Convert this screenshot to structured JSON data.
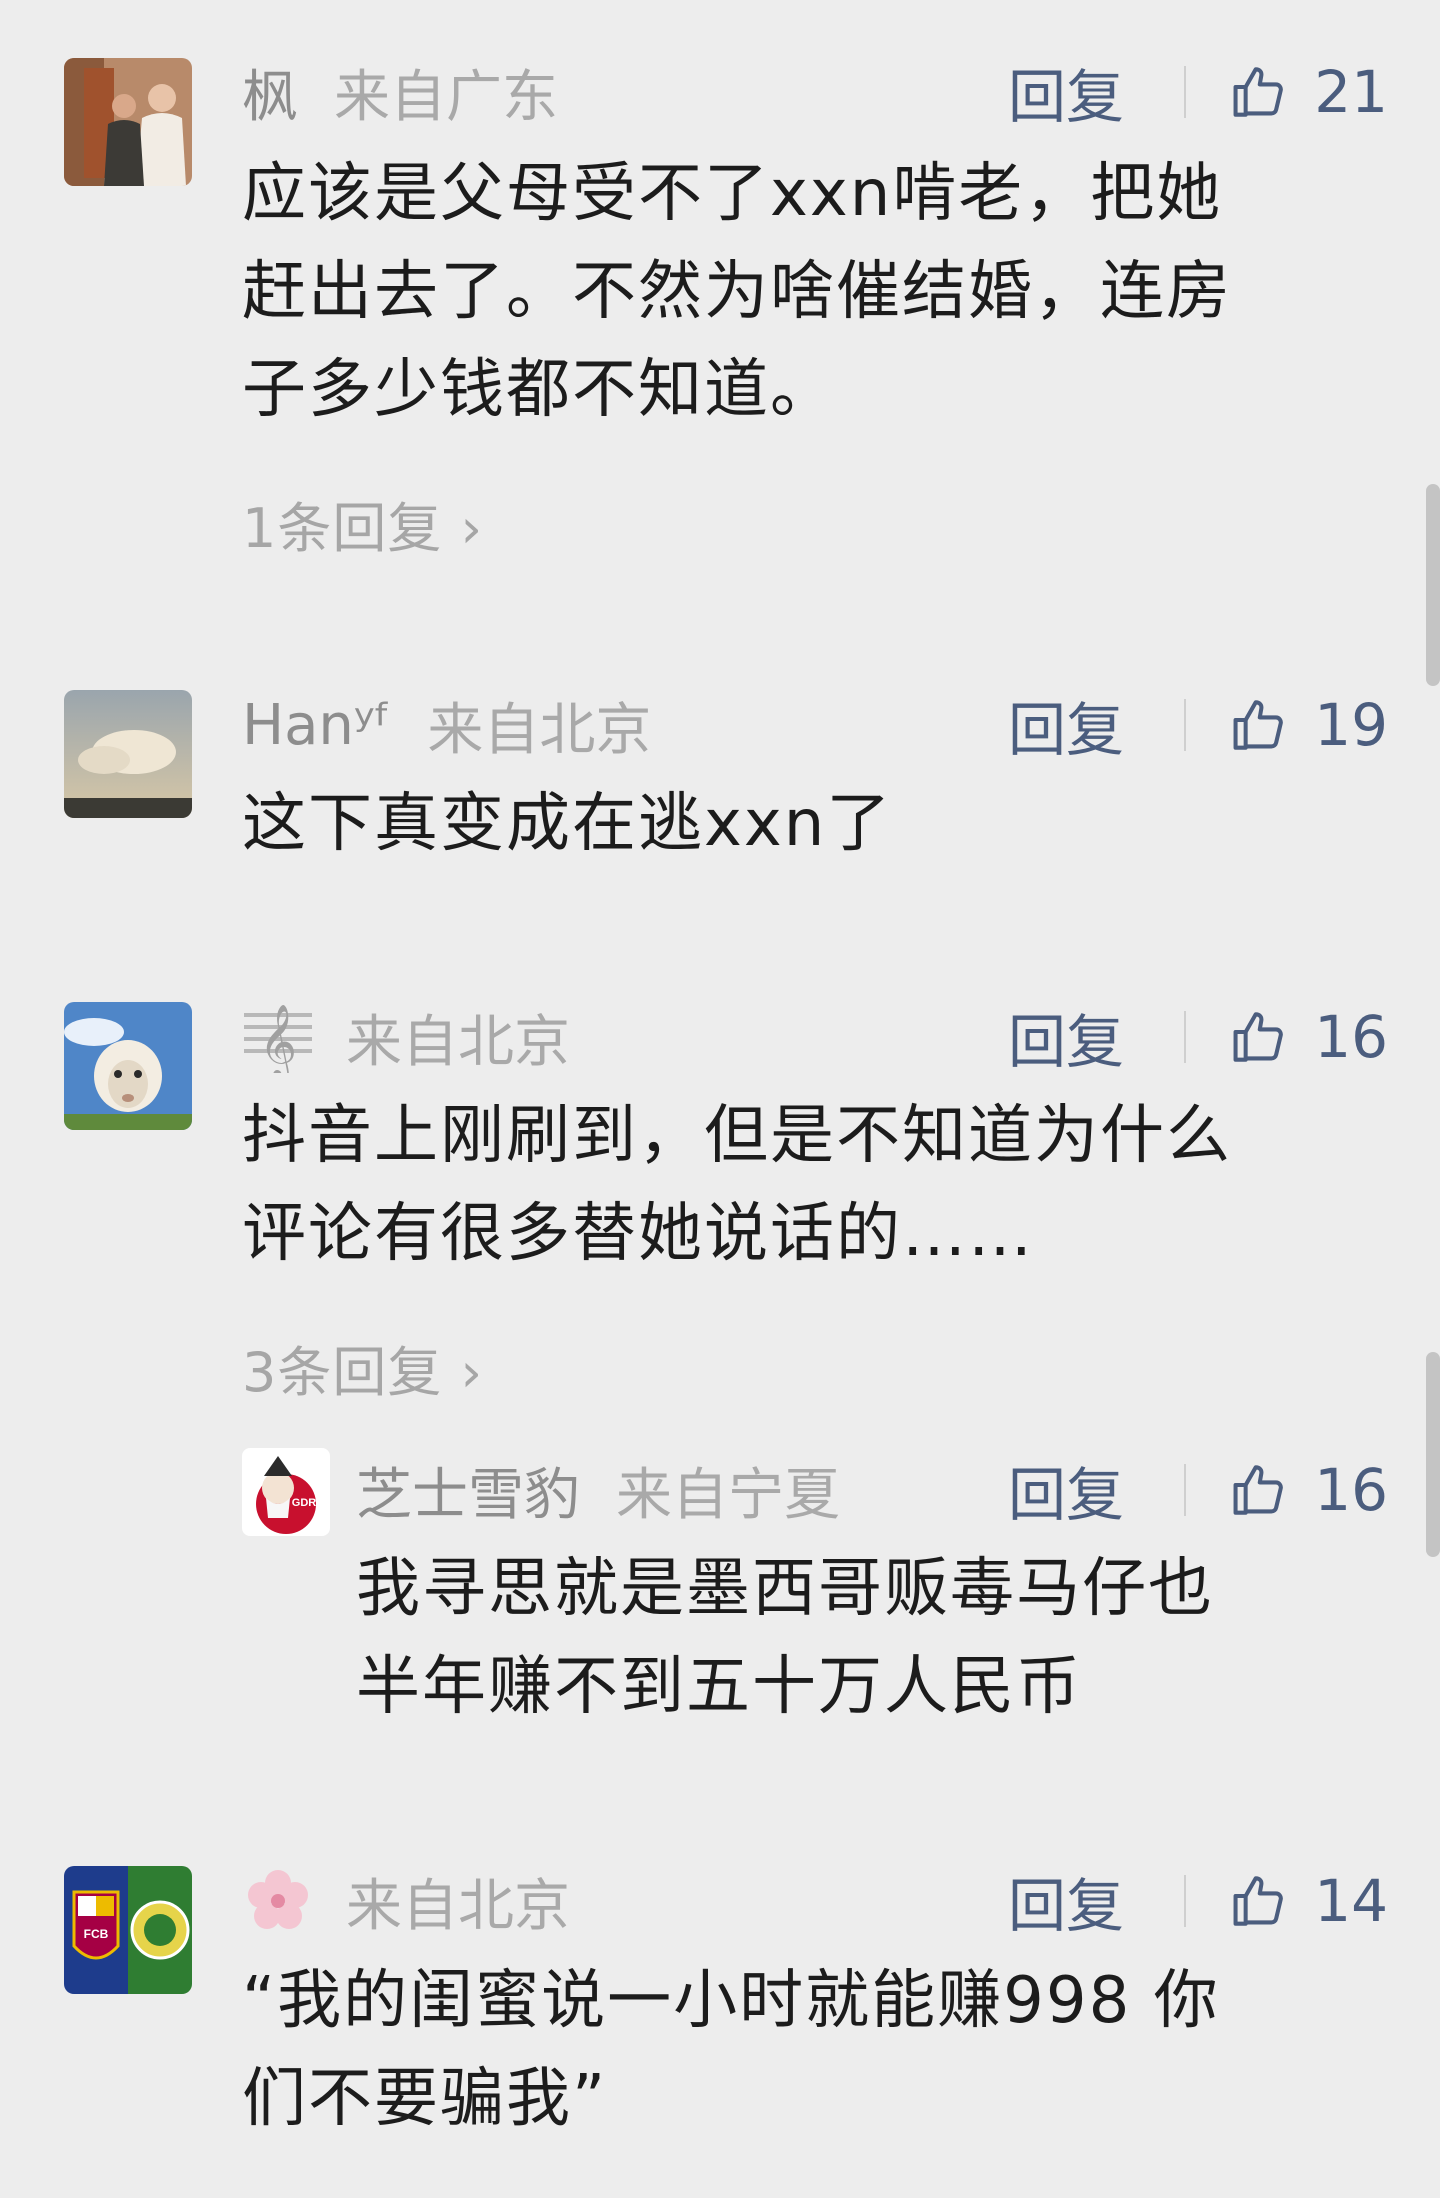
{
  "comments": [
    {
      "name": "枫",
      "location": "来自广东",
      "reply_label": "回复",
      "likes": "21",
      "text_lines": [
        "应该是父母受不了xxn啃老，把她",
        "赶出去了。不然为啥催结婚，连房",
        "子多少钱都不知道。"
      ],
      "replies_link": "1条回复",
      "avatar_icon": "couple-photo-avatar"
    },
    {
      "name": "Hanʸᶠ",
      "location": "来自北京",
      "reply_label": "回复",
      "likes": "19",
      "text_lines": [
        "这下真变成在逃xxn了"
      ],
      "avatar_icon": "sky-clouds-avatar"
    },
    {
      "name_icon": "treble-clef-icon",
      "location": "来自北京",
      "reply_label": "回复",
      "likes": "16",
      "text_lines": [
        "抖音上刚刷到，但是不知道为什么",
        "评论有很多替她说话的……"
      ],
      "replies_link": "3条回复",
      "avatar_icon": "sheep-avatar"
    },
    {
      "name": "芝士雪豹",
      "location": "来自宁夏",
      "reply_label": "回复",
      "likes": "16",
      "text_lines": [
        "我寻思就是墨西哥贩毒马仔也",
        "半年赚不到五十万人民币"
      ],
      "avatar_icon": "colonel-gdr-avatar",
      "avatar_text": "GDR"
    },
    {
      "name_icon": "cherry-blossom-icon",
      "location": "来自北京",
      "reply_label": "回复",
      "likes": "14",
      "text_lines": [
        "“我的闺蜜说一小时就能赚998 你",
        "们不要骗我”"
      ],
      "avatar_icon": "football-badges-avatar",
      "avatar_text": "FCB"
    }
  ],
  "colors": {
    "background": "#ededed",
    "action_blue": "#4b5d7e",
    "meta_gray": "#8d8d8d"
  }
}
